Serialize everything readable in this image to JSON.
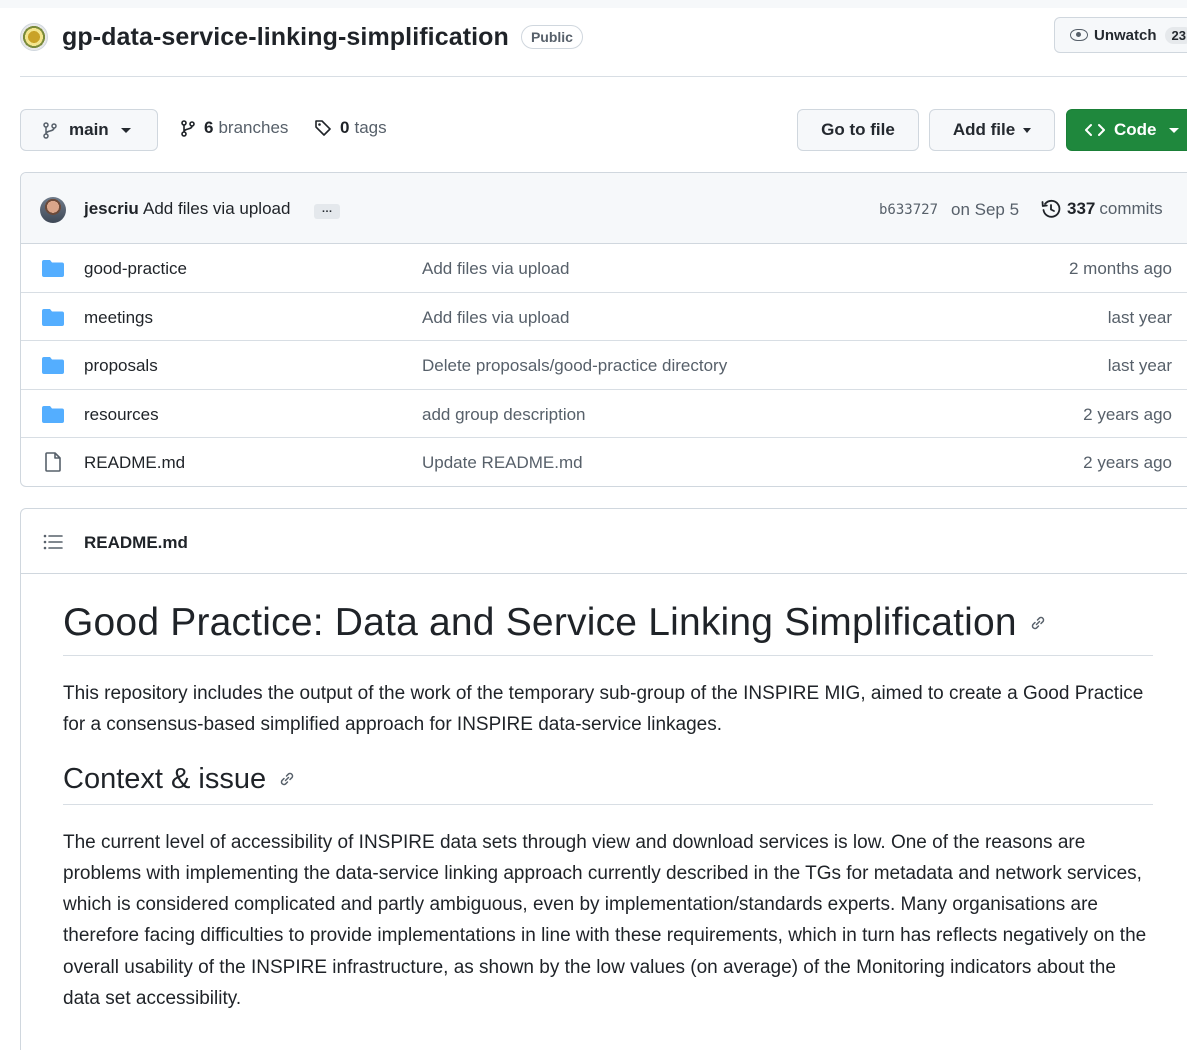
{
  "repo": {
    "name": "gp-data-service-linking-simplification",
    "visibility": "Public",
    "unwatch_label": "Unwatch",
    "unwatch_count": "23"
  },
  "branch_bar": {
    "branch": "main",
    "branches_count": "6",
    "branches_label": "branches",
    "tags_count": "0",
    "tags_label": "tags",
    "go_to_file": "Go to file",
    "add_file": "Add file",
    "code": "Code"
  },
  "latest_commit": {
    "author": "jescriu",
    "message": "Add files via upload",
    "ellipsis": "…",
    "sha": "b633727",
    "date": "on Sep 5",
    "commits_count": "337",
    "commits_label": "commits"
  },
  "files": [
    {
      "type": "dir",
      "name": "good-practice",
      "commit": "Add files via upload",
      "age": "2 months ago"
    },
    {
      "type": "dir",
      "name": "meetings",
      "commit": "Add files via upload",
      "age": "last year"
    },
    {
      "type": "dir",
      "name": "proposals",
      "commit": "Delete proposals/good-practice directory",
      "age": "last year"
    },
    {
      "type": "dir",
      "name": "resources",
      "commit": "add group description",
      "age": "2 years ago"
    },
    {
      "type": "file",
      "name": "README.md",
      "commit": "Update README.md",
      "age": "2 years ago"
    }
  ],
  "readme": {
    "filename": "README.md",
    "h1": "Good Practice: Data and Service Linking Simplification",
    "intro": "This repository includes the output of the work of the temporary sub-group of the INSPIRE MIG, aimed to create a Good Practice for a consensus-based simplified approach for INSPIRE data-service linkages.",
    "h2": "Context & issue",
    "context": "The current level of accessibility of INSPIRE data sets through view and download services is low. One of the reasons are problems with implementing the data-service linking approach currently described in the TGs for metadata and network services, which is considered complicated and partly ambiguous, even by implementation/standards experts. Many organisations are therefore facing difficulties to provide implementations in line with these requirements, which in turn has reflects negatively on the overall usability of the INSPIRE infrastructure, as shown by the low values (on average) of the Monitoring indicators about the data set accessibility."
  },
  "colors": {
    "code_button": "#1f883d",
    "folder_icon": "#54aeff",
    "muted_text": "#57606a",
    "border": "#d0d7de"
  },
  "icons": [
    "repo-avatar",
    "eye-icon",
    "git-branch-icon",
    "tag-icon",
    "history-icon",
    "folder-icon",
    "file-icon",
    "list-unordered-icon",
    "link-icon",
    "code-icon"
  ]
}
